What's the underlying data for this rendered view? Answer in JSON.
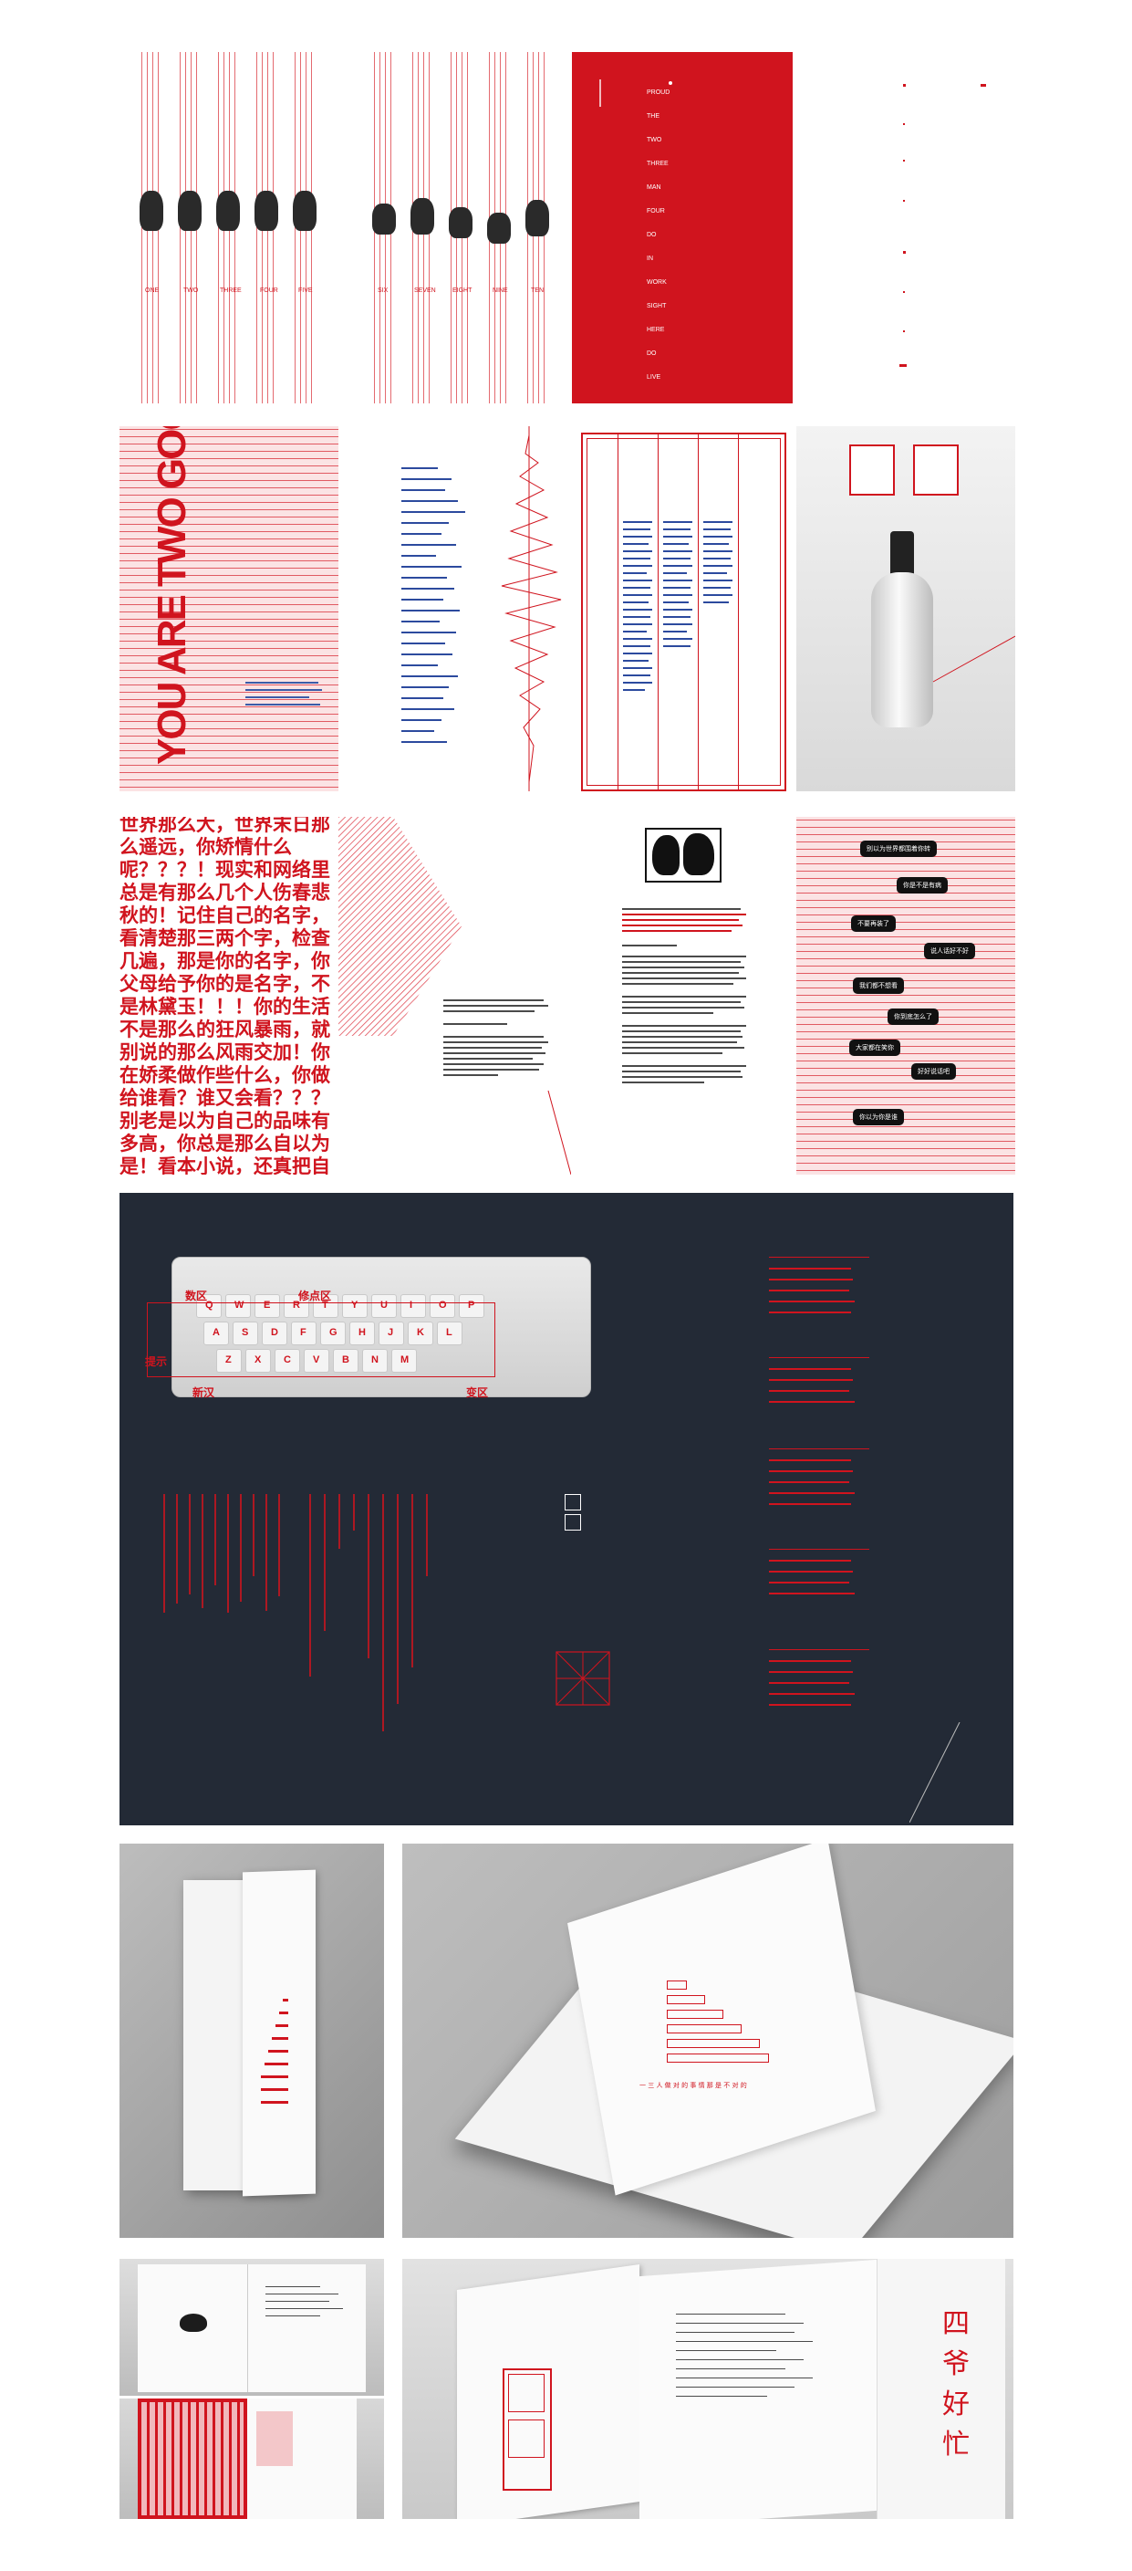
{
  "poster": {
    "tile3_heading": "YOU ARE TWO GOODS!",
    "red_panel_words": [
      "PROUD",
      "THE",
      "TWO",
      "THREE",
      "MAN",
      "FOUR",
      "DO",
      "IN",
      "WORK",
      "SIGHT",
      "HERE",
      "DO",
      "LIVE"
    ],
    "sleeve_labels": [
      "ONE",
      "TWO",
      "THREE",
      "FOUR",
      "FIVE"
    ],
    "sleeve_labels_2": [
      "SIX",
      "SEVEN",
      "EIGHT",
      "NINE",
      "TEN"
    ],
    "big_red_text": "世界那么大，世界末日那么遥远，你矫情什么呢？？？！现实和网络里总是有那么几个人伤春悲秋的！记住自己的名字，看清楚那三两个字，检查几遍，那是你的名字，你父母给予你的是名字，不是林黛玉！！！你的生活不是那么的狂风暴雨，就别说的那么风雨交加！你在娇柔做作些什么，你做给谁看？谁又会看？？？别老是以为自己的品味有多高，你总是那么自以为是！看本小说，还真把自己当里面的主角了？学别人语气说话做什么？！是自己的语言能力丧失了，还是你在向别人展示你的模仿能力很强！！！你真",
    "chat_bubbles": [
      "别以为世界都围着你转",
      "你是不是有病",
      "不要再装了",
      "说人话好不好",
      "我们都不想看",
      "你到底怎么了",
      "大家都在笑你",
      "好好说话吧",
      "你以为你是谁"
    ],
    "keyboard_labels": {
      "zone_1": "数区",
      "zone_2": "修点区",
      "zone_3": "新汉",
      "zone_4": "变区",
      "zone_5": "提示"
    },
    "keyboard_rows": [
      [
        "Q",
        "W",
        "E",
        "R",
        "T",
        "Y",
        "U",
        "I",
        "O",
        "P"
      ],
      [
        "A",
        "S",
        "D",
        "F",
        "G",
        "H",
        "J",
        "K",
        "L"
      ],
      [
        "Z",
        "X",
        "C",
        "V",
        "B",
        "N",
        "M"
      ]
    ],
    "book_spine_text": "四爷好忙",
    "fold_caption": "一 三 人 做 对 的 事 情 那 是 不 对 的"
  },
  "colors": {
    "accent_red": "#d0141e",
    "dark_navy": "#232a36",
    "pink_bg": "#fbe3e4"
  }
}
